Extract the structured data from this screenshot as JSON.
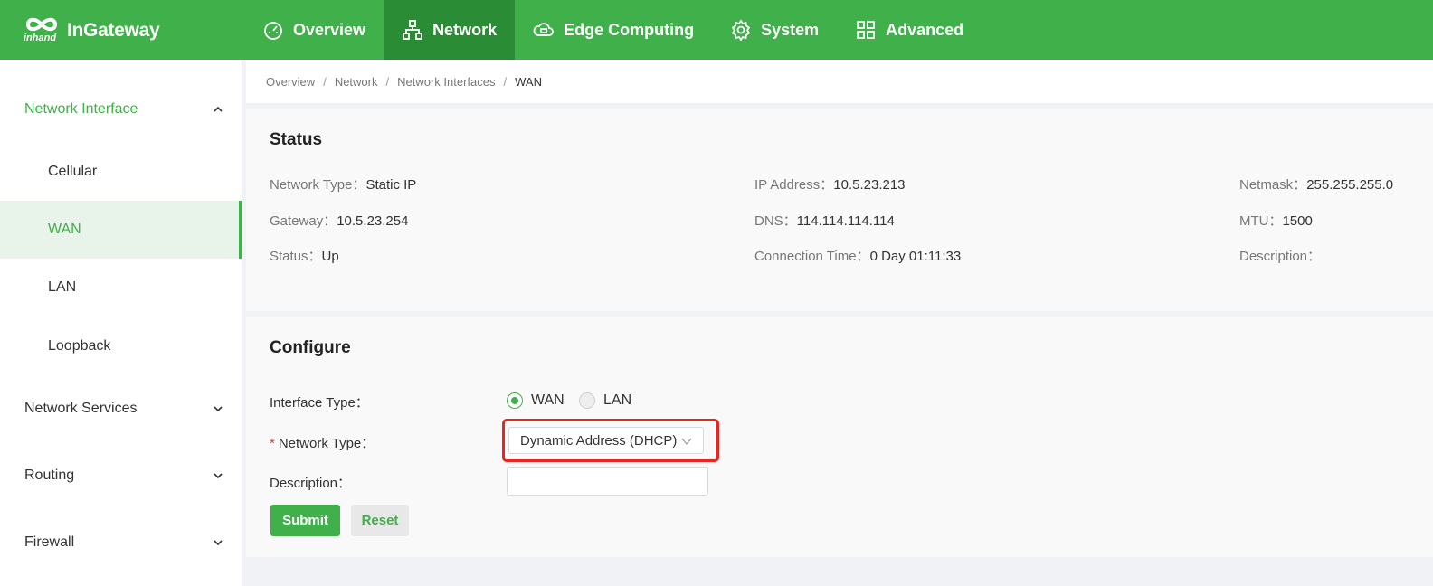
{
  "brand": {
    "name": "InGateway",
    "sub": "inhand"
  },
  "nav": [
    {
      "label": "Overview",
      "icon": "dashboard-icon"
    },
    {
      "label": "Network",
      "icon": "network-icon",
      "active": true
    },
    {
      "label": "Edge Computing",
      "icon": "cloud-icon"
    },
    {
      "label": "System",
      "icon": "gear-icon"
    },
    {
      "label": "Advanced",
      "icon": "grid-icon"
    }
  ],
  "sidebar": {
    "groups": [
      {
        "label": "Network Interface",
        "open": true,
        "items": [
          "Cellular",
          "WAN",
          "LAN",
          "Loopback"
        ],
        "active_item": "WAN"
      },
      {
        "label": "Network Services"
      },
      {
        "label": "Routing"
      },
      {
        "label": "Firewall"
      }
    ]
  },
  "breadcrumb": [
    "Overview",
    "Network",
    "Network Interfaces",
    "WAN"
  ],
  "status": {
    "title": "Status",
    "fields": {
      "network_type": {
        "label": "Network Type：",
        "value": "Static IP"
      },
      "ip_address": {
        "label": "IP Address：",
        "value": "10.5.23.213"
      },
      "netmask": {
        "label": "Netmask：",
        "value": "255.255.255.0"
      },
      "gateway": {
        "label": "Gateway：",
        "value": "10.5.23.254"
      },
      "dns": {
        "label": "DNS：",
        "value": "114.114.114.114"
      },
      "mtu": {
        "label": "MTU：",
        "value": "1500"
      },
      "status": {
        "label": "Status：",
        "value": "Up"
      },
      "connection_time": {
        "label": "Connection Time：",
        "value": "0 Day 01:11:33"
      },
      "description": {
        "label": "Description：",
        "value": ""
      }
    }
  },
  "configure": {
    "title": "Configure",
    "interface_type_label": "Interface Type：",
    "interface_type_options": [
      "WAN",
      "LAN"
    ],
    "interface_type_selected": "WAN",
    "network_type_required": "*",
    "network_type_label": "Network Type：",
    "network_type_value": "Dynamic Address (DHCP)",
    "description_label": "Description：",
    "description_value": "",
    "submit_label": "Submit",
    "reset_label": "Reset"
  },
  "colors": {
    "brand": "#3fb04a",
    "brand_dark": "#2a8c34",
    "highlight": "#e8261f"
  }
}
